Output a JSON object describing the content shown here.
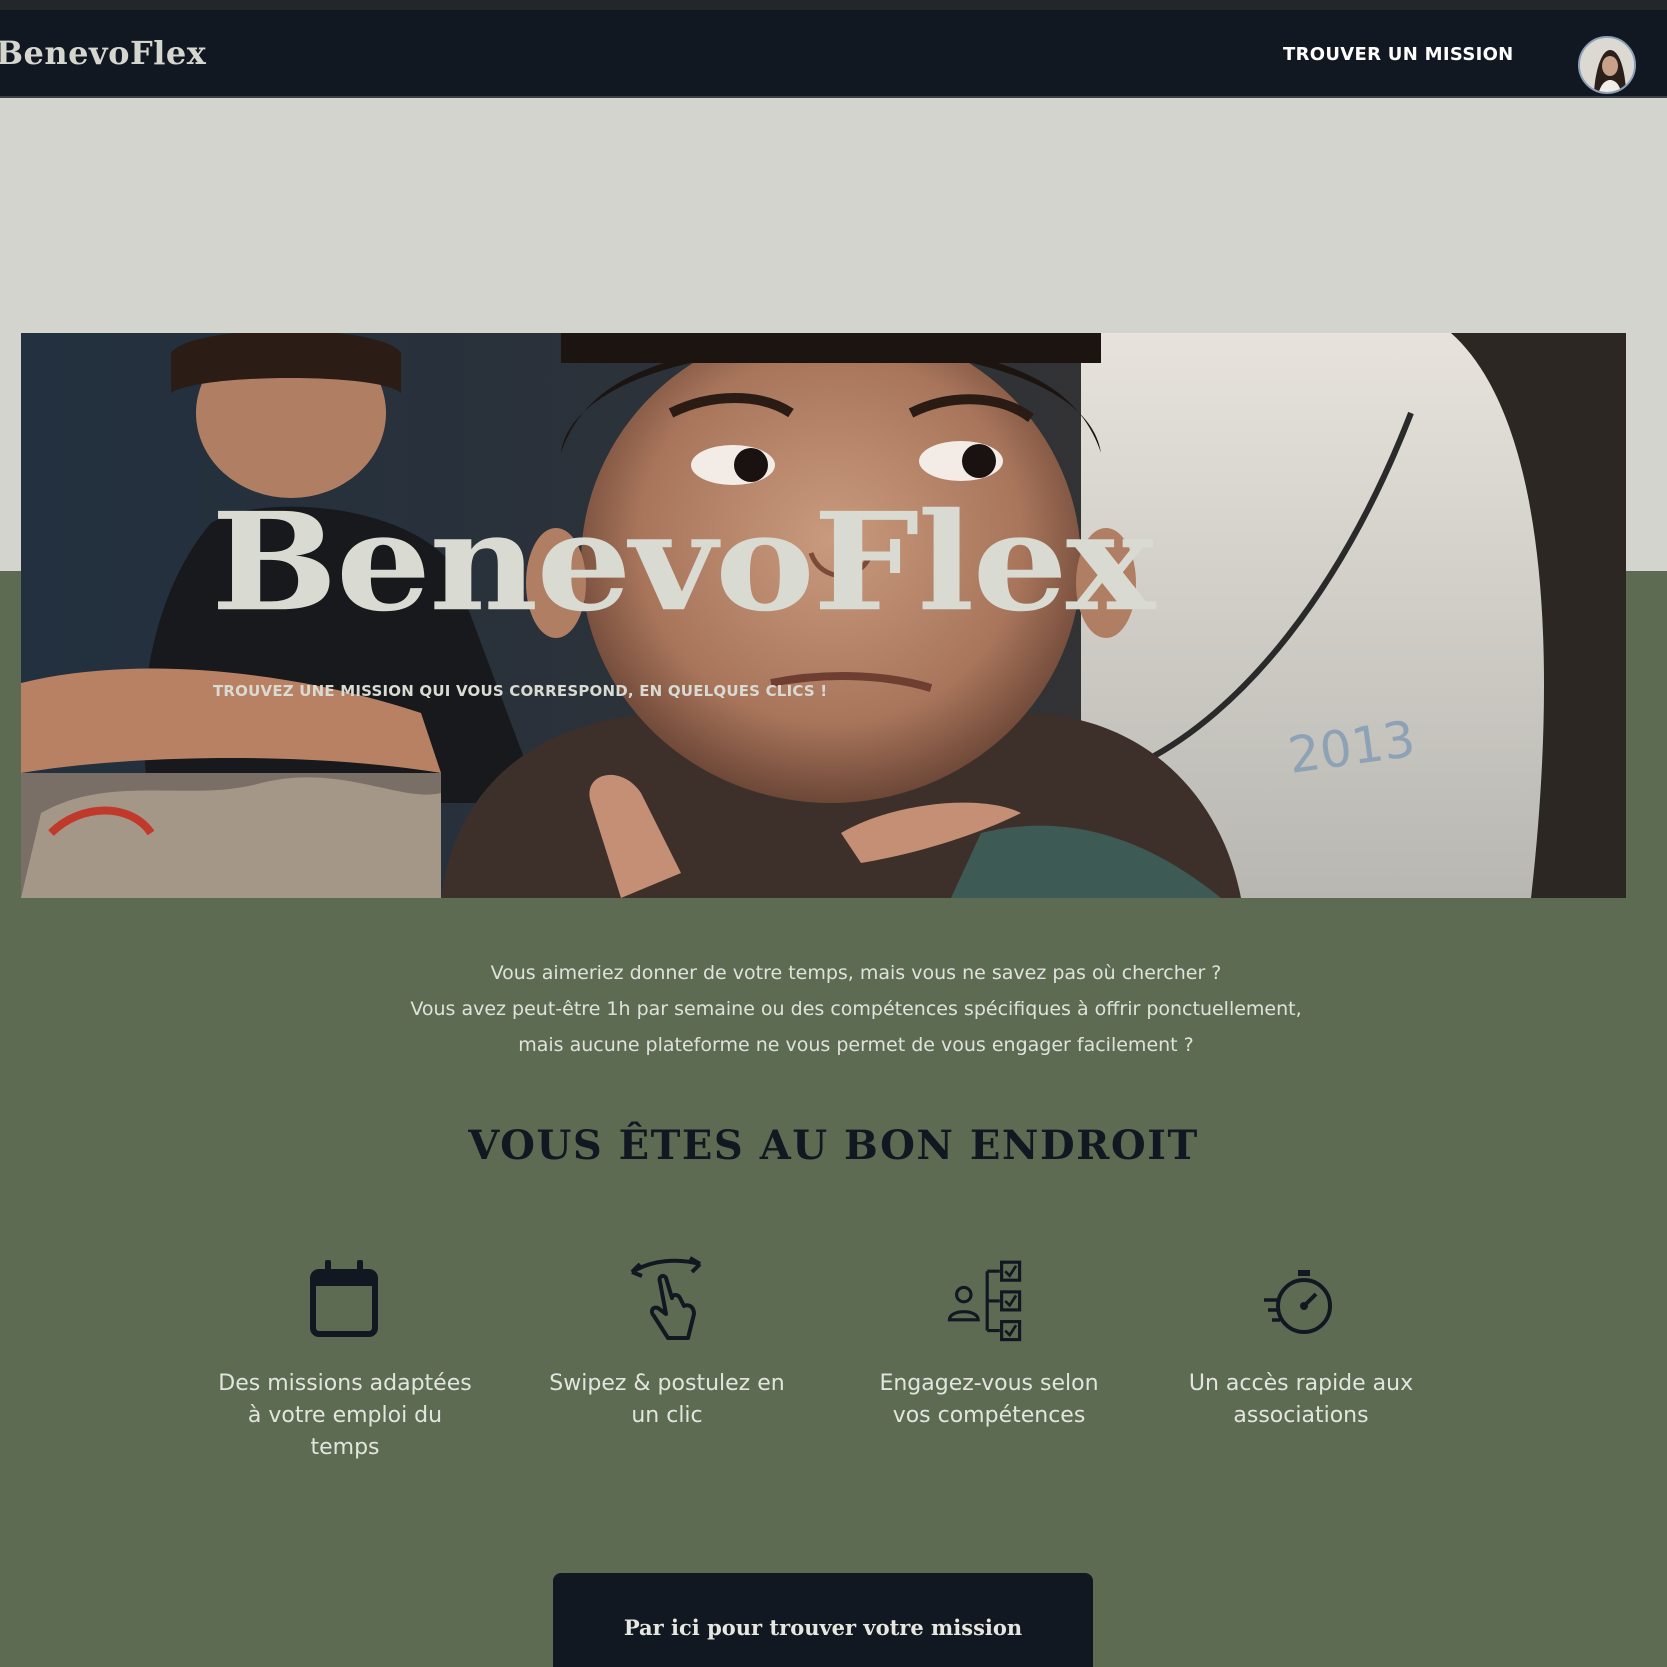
{
  "app": {
    "brand": "BenevoFlex"
  },
  "nav": {
    "link_label": "TROUVER UN MISSION"
  },
  "hero": {
    "title": "BenevoFlex",
    "subtitle": "TROUVEZ UNE MISSION QUI VOUS CORRESPOND, EN QUELQUES CLICS !"
  },
  "intro": {
    "lines": [
      "Vous aimeriez donner de votre temps, mais vous ne savez pas où chercher ?",
      "Vous avez peut-être 1h par semaine ou des compétences spécifiques à offrir ponctuellement,",
      "mais aucune plateforme ne vous permet de vous engager facilement ?"
    ]
  },
  "section": {
    "title": "VOUS ÊTES AU BON ENDROIT"
  },
  "features": [
    {
      "icon": "calendar-icon",
      "label": "Des missions adaptées à votre emploi du temps"
    },
    {
      "icon": "swipe-hand-icon",
      "label": "Swipez & postulez en un clic"
    },
    {
      "icon": "skills-checklist-icon",
      "label": "Engagez-vous selon vos compétences"
    },
    {
      "icon": "stopwatch-icon",
      "label": "Un accès rapide aux associations"
    }
  ],
  "cta": {
    "label": "Par ici pour trouver votre mission"
  },
  "colors": {
    "navbar": "#121821",
    "upper_background": "#d2d4cd",
    "lower_background": "#5e6b53",
    "text_light": "#d9dad2",
    "title_dark": "#121821"
  }
}
